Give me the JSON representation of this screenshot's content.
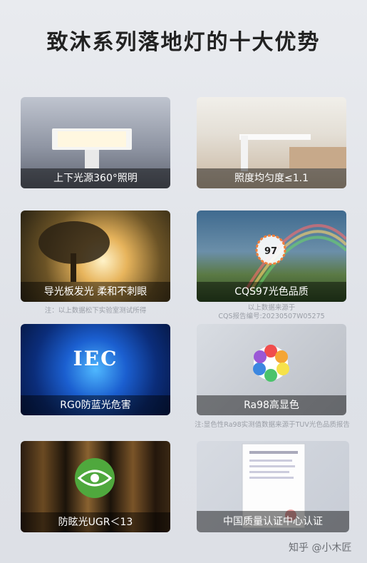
{
  "title": "致沐系列落地灯的十大优势",
  "cards": [
    {
      "caption": "上下光源360°照明"
    },
    {
      "caption": "照度均匀度≤1.1"
    },
    {
      "caption": "导光板发光 柔和不刺眼"
    },
    {
      "caption": "CQS97光色品质",
      "badge": "97"
    },
    {
      "caption": "RG0防蓝光危害",
      "logo": "IEC"
    },
    {
      "caption": "Ra98高显色"
    },
    {
      "caption": "防眩光UGR＜13"
    },
    {
      "caption": "中国质量认证中心认证"
    }
  ],
  "notes": {
    "note1": "注：以上数据松下实验室测试所得",
    "note2_line1": "以上数据来源于",
    "note2_line2": "CQS报告编号:20230507W05275",
    "note3": "注:显色性Ra98实测值数据来源于TUV光色品质报告"
  },
  "watermark": "知乎 @小木匠"
}
